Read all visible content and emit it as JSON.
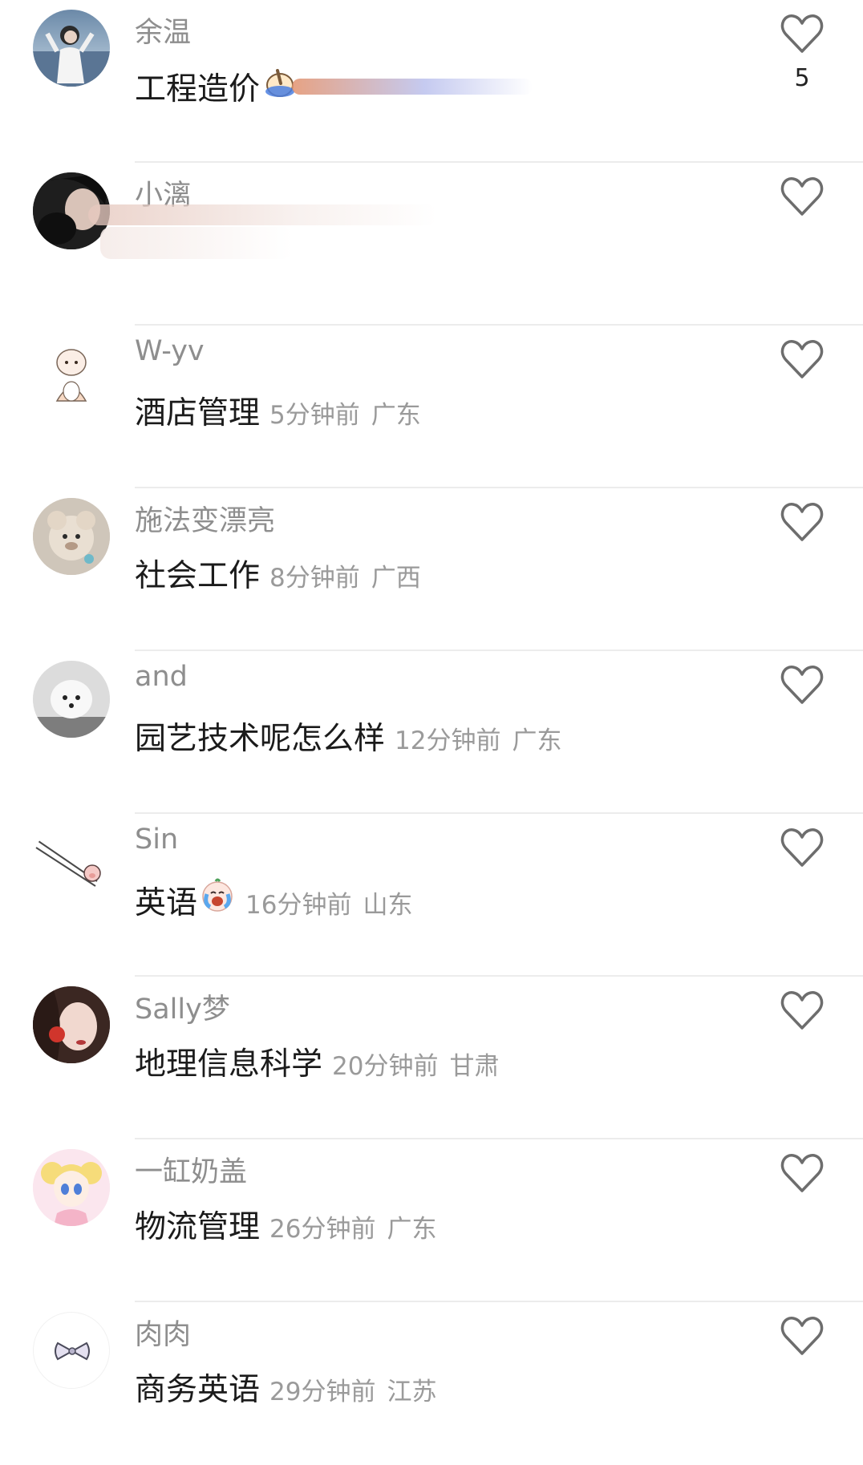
{
  "comments": [
    {
      "username": "余温",
      "text": "工程造价",
      "emoji": "pointing-hand-emoji",
      "time": "",
      "location": "",
      "likes": "5",
      "avatar": "avatar-girl-white-shirt"
    },
    {
      "username": "小漓",
      "text": "",
      "emoji": "",
      "time": "",
      "location": "",
      "likes": "",
      "avatar": "avatar-girl-dark-hair"
    },
    {
      "username": "W-yv",
      "text": "酒店管理",
      "emoji": "",
      "time": "5分钟前",
      "location": "广东",
      "likes": "",
      "avatar": "avatar-cartoon-bunny"
    },
    {
      "username": "施法变漂亮",
      "text": "社会工作",
      "emoji": "",
      "time": "8分钟前",
      "location": "广西",
      "likes": "",
      "avatar": "avatar-teddy-bear"
    },
    {
      "username": "and",
      "text": "园艺技术呢怎么样",
      "emoji": "",
      "time": "12分钟前",
      "location": "广东",
      "likes": "",
      "avatar": "avatar-white-dog"
    },
    {
      "username": "Sin",
      "text": "英语",
      "emoji": "crying-laughing-emoji",
      "time": "16分钟前",
      "location": "山东",
      "likes": "",
      "avatar": "avatar-pig-chopsticks"
    },
    {
      "username": "Sally梦",
      "text": "地理信息科学",
      "emoji": "",
      "time": "20分钟前",
      "location": "甘肃",
      "likes": "",
      "avatar": "avatar-girl-red-flower"
    },
    {
      "username": "一缸奶盖",
      "text": "物流管理",
      "emoji": "",
      "time": "26分钟前",
      "location": "广东",
      "likes": "",
      "avatar": "avatar-anime-girl"
    },
    {
      "username": "肉肉",
      "text": "商务英语",
      "emoji": "",
      "time": "29分钟前",
      "location": "江苏",
      "likes": "",
      "avatar": "avatar-bow"
    }
  ],
  "colors": {
    "username": "#8e8e8e",
    "comment": "#1b1b1b",
    "meta": "#9a9a9a",
    "heart": "#6d6d6d",
    "divider": "#ececec"
  }
}
